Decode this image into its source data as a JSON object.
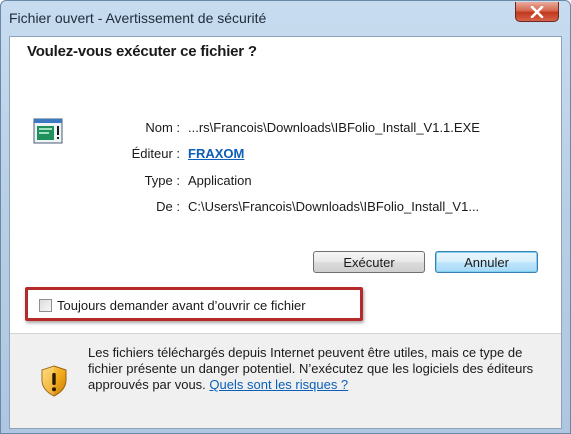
{
  "window": {
    "title": "Fichier ouvert - Avertissement de sécurité"
  },
  "dialog": {
    "prompt": "Voulez-vous exécuter ce fichier ?",
    "file_info": {
      "name_label": "Nom :",
      "name_value": "...rs\\Francois\\Downloads\\IBFolio_Install_V1.1.EXE",
      "publisher_label": "Éditeur :",
      "publisher_value": "FRAXOM",
      "type_label": "Type :",
      "type_value": "Application",
      "from_label": "De :",
      "from_value": "C:\\Users\\Francois\\Downloads\\IBFolio_Install_V1..."
    },
    "buttons": {
      "run": "Exécuter",
      "cancel": "Annuler"
    },
    "checkbox": {
      "label": "Toujours demander avant d’ouvrir ce fichier",
      "checked": false
    },
    "warning": {
      "text": "Les fichiers téléchargés depuis Internet peuvent être utiles, mais ce type de fichier présente un danger potentiel. N’exécutez que les logiciels des éditeurs approuvés par vous.",
      "link": "Quels sont les risques ?"
    }
  },
  "icons": {
    "close": "close-icon",
    "file": "application-icon",
    "warning": "shield-warning-icon"
  },
  "colors": {
    "link": "#0b5fb8",
    "highlight_border": "#b52a2a",
    "shield": "#f0a818"
  }
}
